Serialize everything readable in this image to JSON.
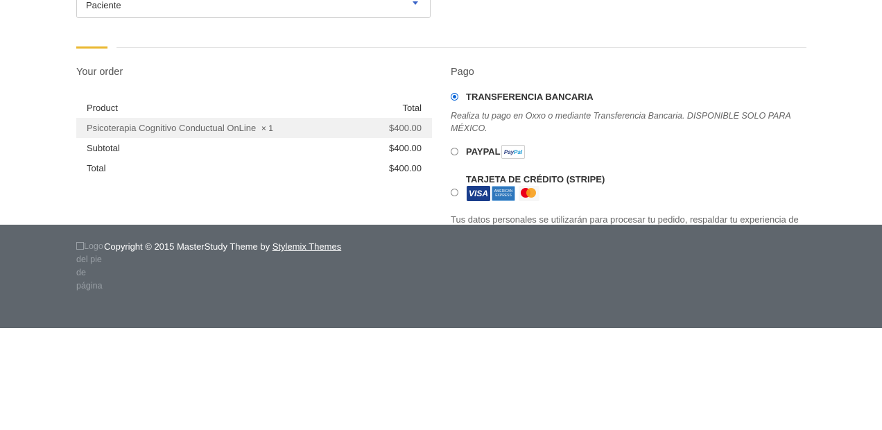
{
  "form": {
    "select_value": "Paciente"
  },
  "order": {
    "heading": "Your order",
    "col_product": "Product",
    "col_total": "Total",
    "item_name": "Psicoterapia Cognitivo Conductual OnLine",
    "item_qty": "× 1",
    "item_total": "$400.00",
    "subtotal_label": "Subtotal",
    "subtotal_value": "$400.00",
    "total_label": "Total",
    "total_value": "$400.00"
  },
  "payment": {
    "heading": "Pago",
    "methods": [
      {
        "label": "TRANSFERENCIA BANCARIA",
        "selected": true,
        "description": "Realiza tu pago en Oxxo o mediante Transferencia Bancaria. DISPONIBLE SOLO PARA MÉXICO."
      },
      {
        "label": "PAYPAL",
        "selected": false,
        "badge_part1": "Pay",
        "badge_part2": "Pal"
      },
      {
        "label": "TARJETA DE CRÉDITO (STRIPE)",
        "selected": false,
        "cards": {
          "visa": "VISA",
          "amex_line1": "AMERICAN",
          "amex_line2": "EXPRESS"
        }
      }
    ],
    "privacy_text": "Tus datos personales se utilizarán para procesar tu pedido, respaldar tu experiencia de"
  },
  "footer": {
    "logo_alt": "Logo del pie de página",
    "copyright_text": "Copyright © 2015 MasterStudy Theme by ",
    "copyright_link": "Stylemix Themes",
    "background": "#5f666d"
  },
  "colors": {
    "accent": "#eab830",
    "radio_active": "#0a66d8",
    "caret": "#3a64c7"
  }
}
